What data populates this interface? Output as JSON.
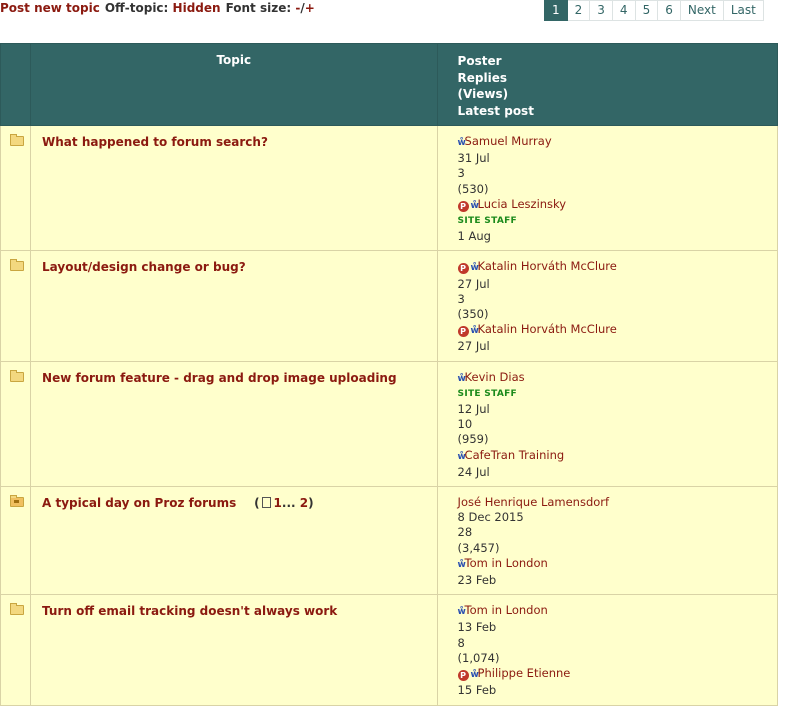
{
  "toolbar": {
    "post_new_topic": "Post new topic",
    "off_topic_label": "Off-topic:",
    "off_topic_value": "Hidden",
    "font_size_label": "Font size:",
    "font_minus": "-",
    "font_sep": "/",
    "font_plus": "+"
  },
  "pagination": {
    "pages": [
      "1",
      "2",
      "3",
      "4",
      "5",
      "6"
    ],
    "active": "1",
    "next": "Next",
    "last": "Last"
  },
  "table": {
    "header_topic": "Topic",
    "header_poster": "Poster",
    "header_replies": "Replies",
    "header_views": "(Views)",
    "header_latest": "Latest post"
  },
  "colors": {
    "header_bg": "#336666",
    "row_bg": "#ffffcc",
    "link": "#8b1a10",
    "staff": "#1b8a1b"
  },
  "icons": {
    "folder": "folder-icon",
    "hot_folder": "hot-folder-icon",
    "pro_badge": "pro-badge-icon",
    "user": "user-icon",
    "page": "page-icon"
  },
  "topics": [
    {
      "title": "What happened to forum search?",
      "poster": "Samuel Murray",
      "posted": "31 Jul",
      "replies": "3",
      "views": "(530)",
      "last_poster": "Lucia Leszinsky",
      "last_staff": "SITE STAFF",
      "last_date": "1 Aug"
    },
    {
      "title": "Layout/design change or bug?",
      "poster": "Katalin Horváth McClure",
      "posted": "27 Jul",
      "replies": "3",
      "views": "(350)",
      "last_poster": "Katalin Horváth McClure",
      "last_date": "27 Jul"
    },
    {
      "title": "New forum feature - drag and drop image uploading",
      "poster": "Kevin Dias",
      "poster_staff": "SITE STAFF",
      "posted": "12 Jul",
      "replies": "10",
      "views": "(959)",
      "last_poster": "CafeTran Training",
      "last_date": "24 Jul"
    },
    {
      "title": "A typical day on Proz forums",
      "pages_open": "(",
      "page_first": "1",
      "page_ellipsis": "...",
      "page_last": "2",
      "pages_close": ")",
      "poster": "José Henrique Lamensdorf",
      "posted": "8 Dec 2015",
      "replies": "28",
      "views": "(3,457)",
      "last_poster": "Tom in London",
      "last_date": "23 Feb"
    },
    {
      "title": "Turn off email tracking doesn't always work",
      "poster": "Tom in London",
      "posted": "13 Feb",
      "replies": "8",
      "views": "(1,074)",
      "last_poster": "Philippe Etienne",
      "last_date": "15 Feb"
    }
  ]
}
